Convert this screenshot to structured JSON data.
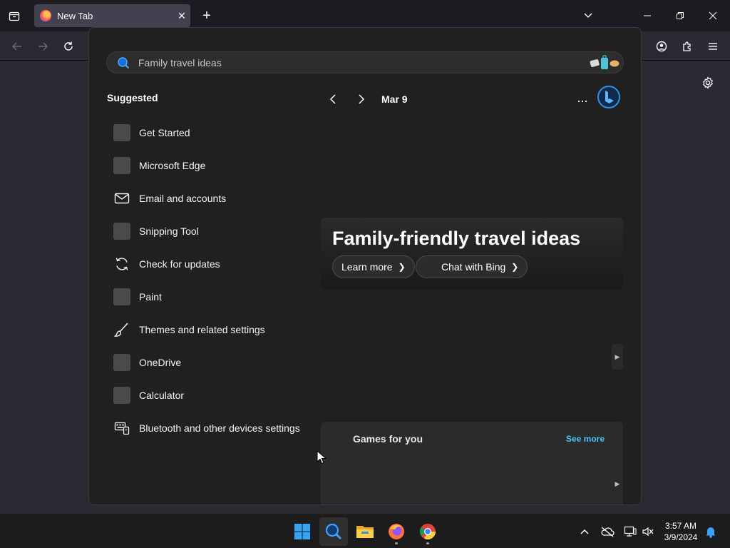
{
  "browser": {
    "tab_title": "New Tab"
  },
  "search": {
    "query": "Family travel ideas"
  },
  "suggested": {
    "title": "Suggested",
    "items": [
      {
        "label": "Get Started",
        "icon": "app-tile-icon"
      },
      {
        "label": "Microsoft Edge",
        "icon": "app-tile-icon"
      },
      {
        "label": "Email and accounts",
        "icon": "mail-icon"
      },
      {
        "label": "Snipping Tool",
        "icon": "app-tile-icon"
      },
      {
        "label": "Check for updates",
        "icon": "refresh-icon"
      },
      {
        "label": "Paint",
        "icon": "app-tile-icon"
      },
      {
        "label": "Themes and related settings",
        "icon": "brush-icon"
      },
      {
        "label": "OneDrive",
        "icon": "app-tile-icon"
      },
      {
        "label": "Calculator",
        "icon": "app-tile-icon"
      },
      {
        "label": "Bluetooth and other devices settings",
        "icon": "devices-icon"
      }
    ]
  },
  "highlights": {
    "date": "Mar 9",
    "more": "...",
    "hero_title": "Family-friendly travel ideas",
    "learn_more": "Learn more",
    "chat_bing": "Chat with Bing"
  },
  "games": {
    "title": "Games for you",
    "see_more": "See more"
  },
  "taskbar": {
    "time": "3:57 AM",
    "date": "3/9/2024"
  },
  "colors": {
    "accent_link": "#4cc2ff",
    "flyout_bg": "#202020",
    "taskbar_bg": "#1c1c1c"
  }
}
